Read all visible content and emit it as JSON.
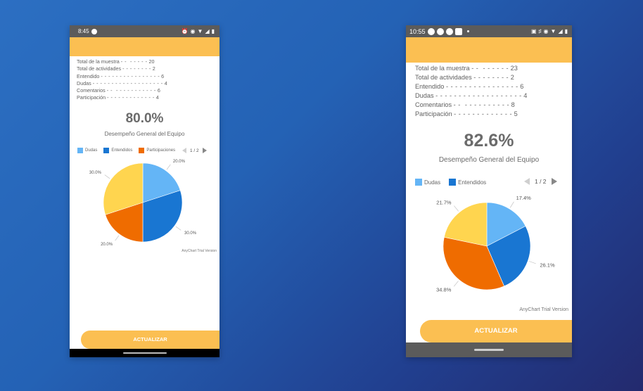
{
  "colors": {
    "accent": "#fbbf52",
    "dudas": "#64b5f6",
    "entendidos": "#1976d2",
    "participaciones": "#ef6c00",
    "comentarios": "#ffd54f"
  },
  "phones": [
    {
      "time": "8:45",
      "stats": [
        {
          "label": "Total de la muestra",
          "dashes": "- -  - - - - -",
          "value": "20"
        },
        {
          "label": "Total de actividades",
          "dashes": "- - - - - - - -",
          "value": "2"
        },
        {
          "label": "Entendido",
          "dashes": "- - - - - - - - - - - - - - - -",
          "value": "6"
        },
        {
          "label": "Dudas",
          "dashes": "- - - - - - - - - - - - - - - - - - -",
          "value": "4"
        },
        {
          "label": "Comentarios",
          "dashes": "- -  - - - - - - - - - - -",
          "value": "6"
        },
        {
          "label": "Participación",
          "dashes": "- - - - - - - - - - - - -",
          "value": "4"
        }
      ],
      "percent": "80.0%",
      "subtitle": "Desempeño General del Equipo",
      "legend": [
        {
          "label": "Dudas",
          "color_key": "dudas"
        },
        {
          "label": "Entendidos",
          "color_key": "entendidos"
        },
        {
          "label": "Participaciones",
          "color_key": "participaciones"
        }
      ],
      "pager": "1 / 2",
      "trial": "AnyChart Trial Version",
      "button": "ACTUALIZAR",
      "chart_data": {
        "type": "pie",
        "slices": [
          {
            "value": 20.0,
            "label": "20.0%",
            "color_key": "dudas"
          },
          {
            "value": 30.0,
            "label": "30.0%",
            "color_key": "entendidos"
          },
          {
            "value": 20.0,
            "label": "20.0%",
            "color_key": "participaciones"
          },
          {
            "value": 30.0,
            "label": "30.0%",
            "color_key": "comentarios"
          }
        ]
      }
    },
    {
      "time": "10:55",
      "stats": [
        {
          "label": "Total de la muestra",
          "dashes": "- -  - - - - - -",
          "value": "23"
        },
        {
          "label": "Total de actividades",
          "dashes": "- - - - - - - -",
          "value": "2"
        },
        {
          "label": "Entendido",
          "dashes": "- - - - - - - - - - - - - - - -",
          "value": "6"
        },
        {
          "label": "Dudas",
          "dashes": "- - - - - - - - - - - - - - - - - - -",
          "value": "4"
        },
        {
          "label": "Comentarios",
          "dashes": "- -  - - - - - - - - - -",
          "value": "8"
        },
        {
          "label": "Participación",
          "dashes": "- - - - - - - - - - - - -",
          "value": "5"
        }
      ],
      "percent": "82.6%",
      "subtitle": "Desempeño General del Equipo",
      "legend": [
        {
          "label": "Dudas",
          "color_key": "dudas"
        },
        {
          "label": "Entendidos",
          "color_key": "entendidos"
        }
      ],
      "pager": "1 / 2",
      "trial": "AnyChart Trial Version",
      "button": "ACTUALIZAR",
      "chart_data": {
        "type": "pie",
        "slices": [
          {
            "value": 17.4,
            "label": "17.4%",
            "color_key": "dudas"
          },
          {
            "value": 26.1,
            "label": "26.1%",
            "color_key": "entendidos"
          },
          {
            "value": 34.8,
            "label": "34.8%",
            "color_key": "participaciones"
          },
          {
            "value": 21.7,
            "label": "21.7%",
            "color_key": "comentarios"
          }
        ]
      }
    }
  ]
}
